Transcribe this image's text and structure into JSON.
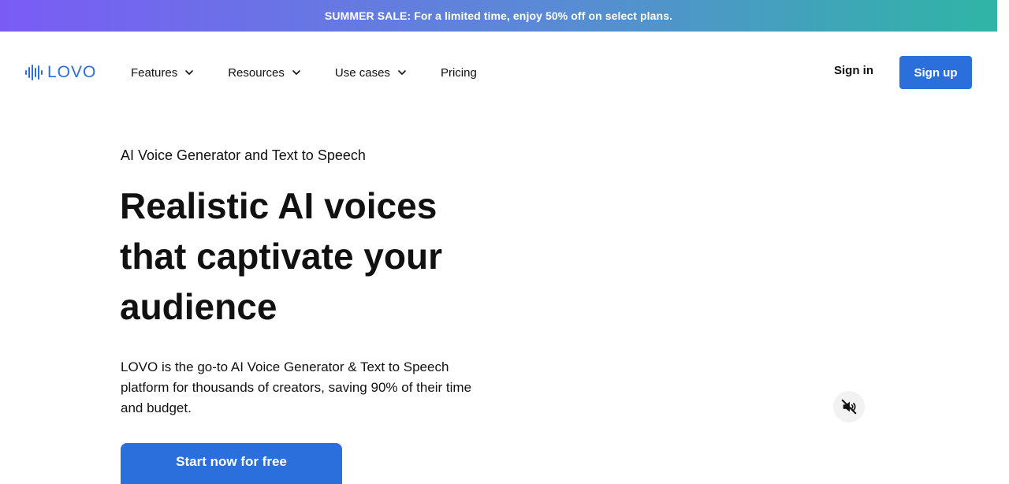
{
  "banner": {
    "text": "SUMMER SALE: For a limited time, enjoy 50% off on select plans."
  },
  "header": {
    "logo_text": "LOVO",
    "nav": [
      {
        "label": "Features",
        "dropdown": true
      },
      {
        "label": "Resources",
        "dropdown": true
      },
      {
        "label": "Use cases",
        "dropdown": true
      },
      {
        "label": "Pricing",
        "dropdown": false
      }
    ],
    "sign_in": "Sign in",
    "sign_up": "Sign up"
  },
  "hero": {
    "eyebrow": "AI Voice Generator and Text to Speech",
    "headline": "Realistic AI voices that captivate your audience",
    "description": "LOVO is the go-to AI Voice Generator & Text to Speech platform for thousands of creators, saving 90% of their time and budget.",
    "cta": "Start now for free"
  },
  "media": {
    "mute_icon": "speaker-muted-icon"
  },
  "colors": {
    "brand_blue": "#2a6fdb",
    "banner_gradient_start": "#7a5cf5",
    "banner_gradient_end": "#2fb5a6"
  }
}
